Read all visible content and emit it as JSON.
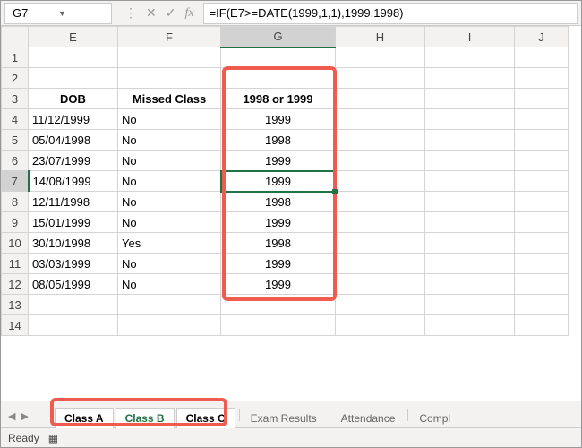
{
  "namebox": "G7",
  "formula": "=IF(E7>=DATE(1999,1,1),1999,1998)",
  "columns": [
    "E",
    "F",
    "G",
    "H",
    "I",
    "J"
  ],
  "rows": [
    "1",
    "2",
    "3",
    "4",
    "5",
    "6",
    "7",
    "8",
    "9",
    "10",
    "11",
    "12",
    "13",
    "14"
  ],
  "headers": {
    "E": "DOB",
    "F": "Missed Class",
    "G": "1998 or 1999"
  },
  "data": {
    "4": {
      "E": "11/12/1999",
      "F": "No",
      "G": "1999"
    },
    "5": {
      "E": "05/04/1998",
      "F": "No",
      "G": "1998"
    },
    "6": {
      "E": "23/07/1999",
      "F": "No",
      "G": "1999"
    },
    "7": {
      "E": "14/08/1999",
      "F": "No",
      "G": "1999"
    },
    "8": {
      "E": "12/11/1998",
      "F": "No",
      "G": "1998"
    },
    "9": {
      "E": "15/01/1999",
      "F": "No",
      "G": "1999"
    },
    "10": {
      "E": "30/10/1998",
      "F": "Yes",
      "G": "1998"
    },
    "11": {
      "E": "03/03/1999",
      "F": "No",
      "G": "1999"
    },
    "12": {
      "E": "08/05/1999",
      "F": "No",
      "G": "1999"
    }
  },
  "tabs": {
    "a": "Class A",
    "b": "Class B",
    "c": "Class C",
    "exam": "Exam Results",
    "att": "Attendance",
    "comp": "Compl"
  },
  "status": "Ready",
  "chart_data": {
    "type": "table",
    "title": "1998 or 1999",
    "columns": [
      "DOB",
      "Missed Class",
      "1998 or 1999"
    ],
    "rows": [
      [
        "11/12/1999",
        "No",
        1999
      ],
      [
        "05/04/1998",
        "No",
        1998
      ],
      [
        "23/07/1999",
        "No",
        1999
      ],
      [
        "14/08/1999",
        "No",
        1999
      ],
      [
        "12/11/1998",
        "No",
        1998
      ],
      [
        "15/01/1999",
        "No",
        1999
      ],
      [
        "30/10/1998",
        "Yes",
        1998
      ],
      [
        "03/03/1999",
        "No",
        1999
      ],
      [
        "08/05/1999",
        "No",
        1999
      ]
    ]
  }
}
